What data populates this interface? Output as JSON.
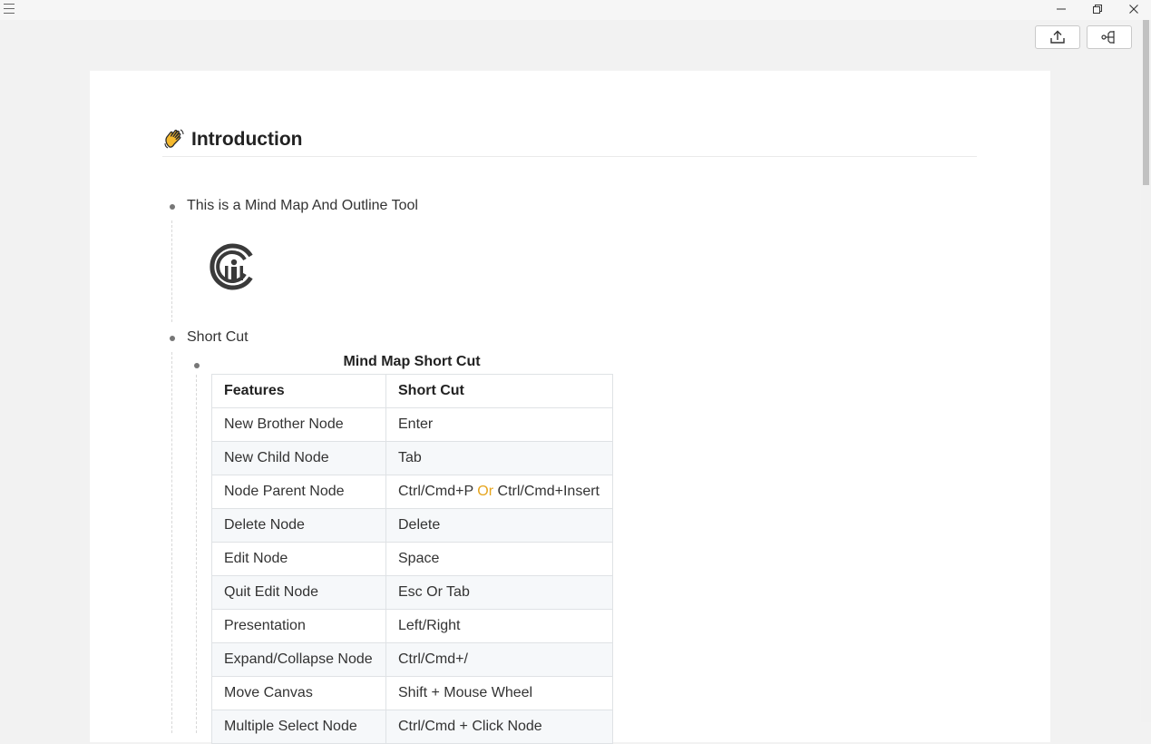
{
  "window": {
    "menu_icon": "hamburger-icon",
    "minimize_icon": "minimize-icon",
    "maximize_icon": "restore-icon",
    "close_icon": "close-icon"
  },
  "toolbar": {
    "export_icon": "export-upload-icon",
    "mindmap_icon": "mindmap-view-icon"
  },
  "document": {
    "heading": {
      "emoji": "waving-hand-icon",
      "title": "Introduction"
    },
    "nodes": [
      {
        "text": "This is a Mind Map And Outline Tool",
        "image": "app-logo-icon"
      },
      {
        "text": "Short Cut"
      }
    ],
    "table": {
      "caption": "Mind Map Short Cut",
      "headers": [
        "Features",
        "Short Cut"
      ],
      "rows": [
        [
          "New Brother Node",
          "Enter"
        ],
        [
          "New Child Node",
          "Tab"
        ],
        [
          "Node Parent Node",
          "Ctrl/Cmd+P",
          "Or",
          "Ctrl/Cmd+Insert"
        ],
        [
          "Delete Node",
          "Delete"
        ],
        [
          "Edit Node",
          "Space"
        ],
        [
          "Quit Edit Node",
          "Esc Or Tab"
        ],
        [
          "Presentation",
          "Left/Right"
        ],
        [
          "Expand/Collapse Node",
          "Ctrl/Cmd+/"
        ],
        [
          "Move Canvas",
          "Shift + Mouse Wheel"
        ],
        [
          "Multiple Select Node",
          "Ctrl/Cmd + Click Node"
        ]
      ]
    }
  },
  "colors": {
    "accent_or": "#e6a51e",
    "background": "#f2f2f2",
    "paper": "#ffffff"
  }
}
